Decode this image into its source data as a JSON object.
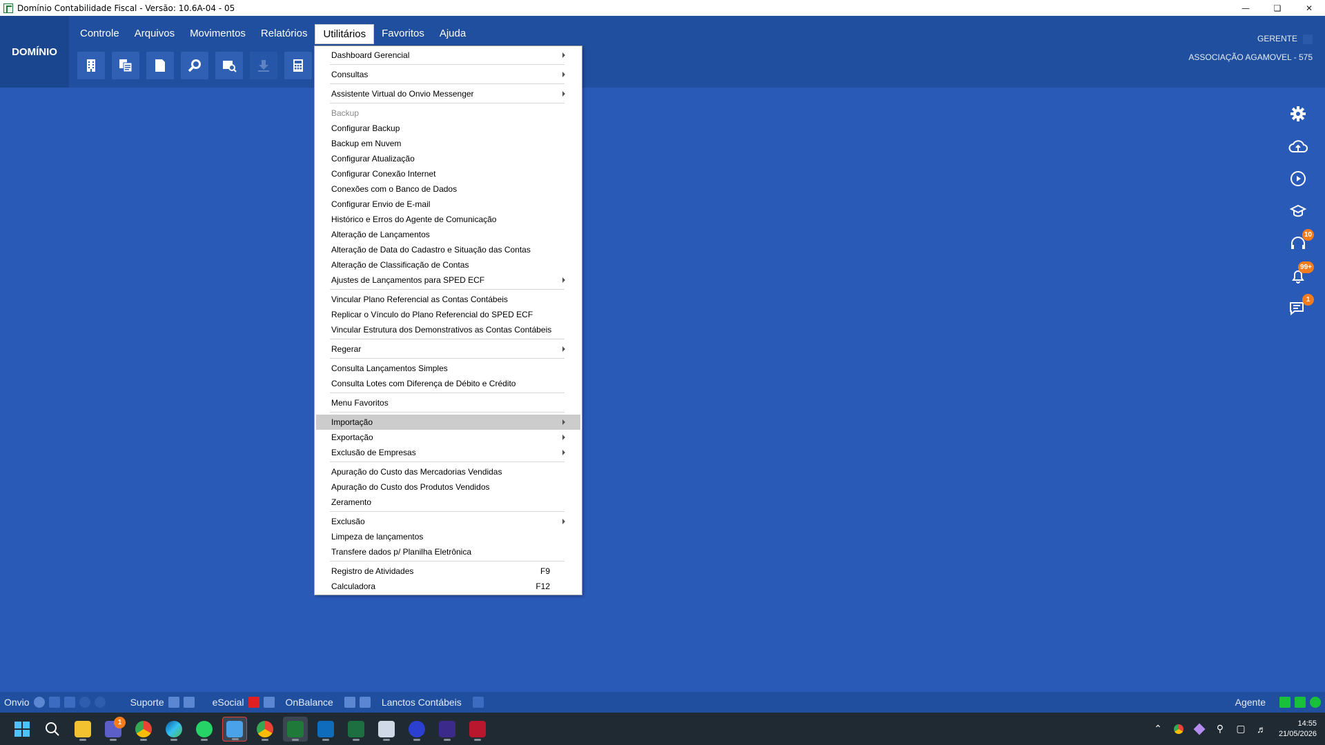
{
  "window": {
    "title": "Domínio Contabilidade Fiscal  - Versão: 10.6A-04 - 05"
  },
  "brand": "DOMÍNIO",
  "menubar": [
    "Controle",
    "Arquivos",
    "Movimentos",
    "Relatórios",
    "Utilitários",
    "Favoritos",
    "Ajuda"
  ],
  "header": {
    "user": "GERENTE",
    "company": "ASSOCIAÇÃO AGAMOVEL  - 575"
  },
  "badges": {
    "support": "10",
    "notifications": "99+",
    "chat": "1"
  },
  "dropdown": {
    "items": [
      "Dashboard Gerencial",
      "Consultas",
      "Assistente Virtual do Onvio Messenger",
      "Backup",
      "Configurar Backup",
      "Backup em Nuvem",
      "Configurar Atualização",
      "Configurar Conexão Internet",
      "Conexões com o Banco de Dados",
      "Configurar Envio de E-mail",
      "Histórico e Erros do Agente de Comunicação",
      "Alteração de Lançamentos",
      "Alteração de Data do Cadastro e Situação das Contas",
      "Alteração de Classificação de Contas",
      "Ajustes de Lançamentos para SPED ECF",
      "Vincular Plano Referencial as Contas Contábeis",
      "Replicar o Vínculo do Plano Referencial do SPED ECF",
      "Vincular Estrutura dos Demonstrativos as Contas Contábeis",
      "Regerar",
      "Consulta Lançamentos Simples",
      "Consulta Lotes com Diferença de Débito e Crédito",
      "Menu Favoritos",
      "Importação",
      "Exportação",
      "Exclusão de Empresas",
      "Apuração do Custo das Mercadorias Vendidas",
      "Apuração do Custo dos Produtos Vendidos",
      "Zeramento",
      "Exclusão",
      "Limpeza de lançamentos",
      "Transfere dados p/ Planilha Eletrônica",
      "Registro de Atividades",
      "Calculadora"
    ],
    "shortcuts": {
      "registro": "F9",
      "calculadora": "F12"
    }
  },
  "statusbar": {
    "onvio": "Onvio",
    "suporte": "Suporte",
    "esocial": "eSocial",
    "onbalance": "OnBalance",
    "lanctos": "Lanctos Contábeis",
    "agente": "Agente"
  },
  "taskbar": {
    "teams_badge": "1",
    "time": "14:55",
    "date": "21/05/2026"
  },
  "colors": {
    "background": "#2a5ab8",
    "header": "#1f4f9e",
    "badge": "#f57c1c",
    "highlight": "#cccccc"
  }
}
